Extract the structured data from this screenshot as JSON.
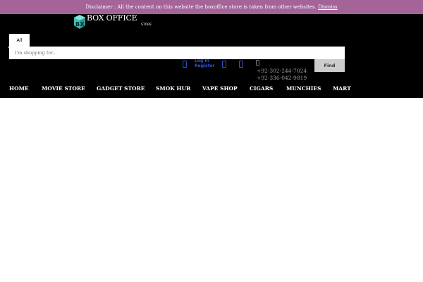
{
  "notice": {
    "text": "Disclaimer : All the content on this website the boxoffice store is taken from other websites.",
    "dismiss": "Dismiss"
  },
  "logo": {
    "title": "BOX OFFICE",
    "subtitle": "STORE"
  },
  "search": {
    "category": "All",
    "placeholder": "I'm shopping for...",
    "button": "Find"
  },
  "account": {
    "login": "Log In",
    "register": "Register"
  },
  "contact": {
    "phones": [
      "+92-302-244-7024",
      "+92-336-042-9819"
    ]
  },
  "icons": {
    "user": "user-icon",
    "wishlist": "heart-icon",
    "cart": "cart-icon",
    "phone": "phone-icon"
  },
  "nav": {
    "items": [
      "HOME",
      "MOVIE STORE",
      "GADGET STORE",
      "SMOK HUB",
      "VAPE SHOP",
      "CIGARS",
      "MUNCHIES",
      "MART"
    ]
  },
  "colors": {
    "notice_bg": "#a46497",
    "header_bg": "#000000",
    "link": "#3355cc",
    "logo_accent": "#4fd1c5"
  }
}
